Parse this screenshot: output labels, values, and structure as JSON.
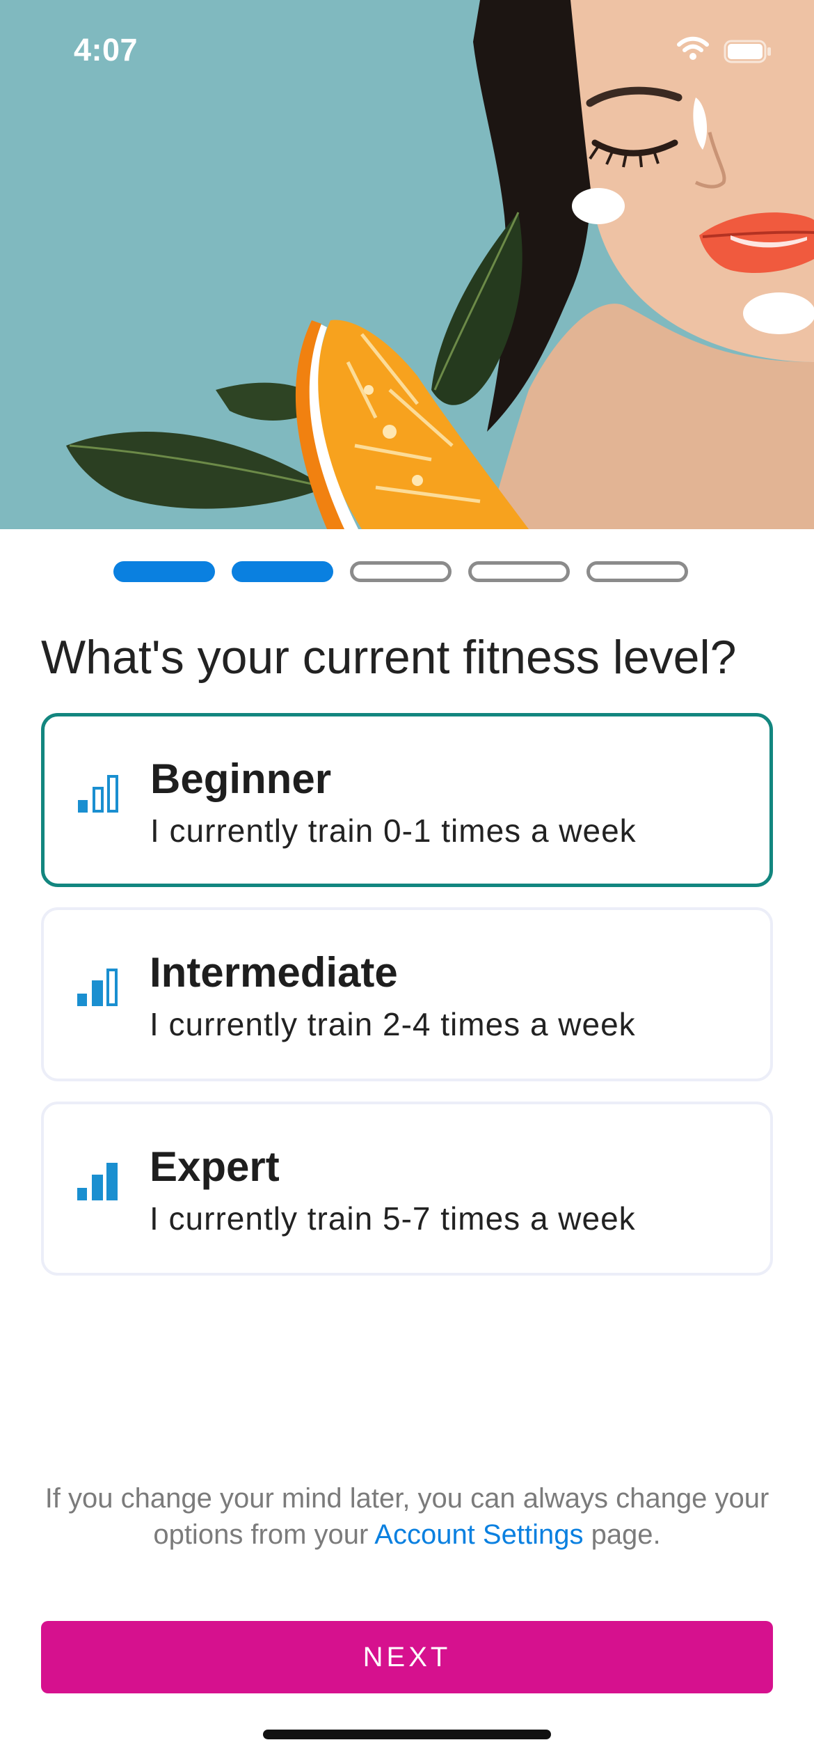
{
  "status_bar": {
    "time": "4:07",
    "icons": [
      "wifi-icon",
      "battery-icon"
    ]
  },
  "hero": {
    "image": "woman-with-face-cream-and-orange-slice"
  },
  "stepper": {
    "total_steps": 5,
    "completed_steps": 2,
    "colors": {
      "done": "#0a80e0",
      "todo": "#8b8b8b"
    }
  },
  "question": "What's your current fitness level?",
  "options": [
    {
      "title": "Beginner",
      "subtitle": "I currently train 0-1 times a week",
      "icon": "signal-level-1-icon",
      "selected": true
    },
    {
      "title": "Intermediate",
      "subtitle": "I currently train 2-4 times a week",
      "icon": "signal-level-2-icon",
      "selected": false
    },
    {
      "title": "Expert",
      "subtitle": "I currently train 5-7 times a week",
      "icon": "signal-level-3-icon",
      "selected": false
    }
  ],
  "footnote": {
    "before": "If you change your mind later, you can always change your options from your ",
    "link": "Account Settings",
    "after": " page."
  },
  "next_button": {
    "label": "NEXT"
  },
  "colors": {
    "accent_blue": "#0a80e0",
    "selected_border": "#13867f",
    "icon_blue": "#1a8fd0",
    "button_magenta": "#d6118e",
    "hero_bg": "#80b9bf"
  }
}
